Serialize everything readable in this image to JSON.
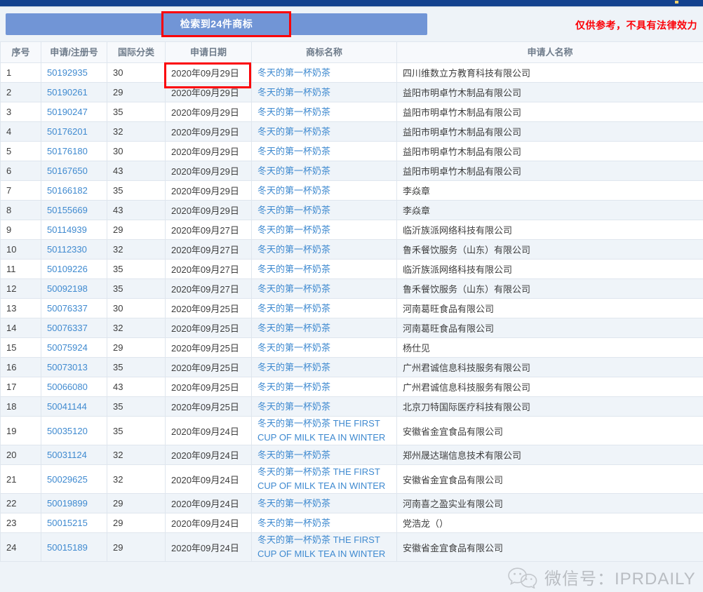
{
  "topbar": {
    "marker": ""
  },
  "banner": {
    "title": "检索到24件商标",
    "disclaimer": "仅供参考，不具有法律效力"
  },
  "table": {
    "headers": {
      "index": "序号",
      "app_no": "申请/注册号",
      "intl_class": "国际分类",
      "app_date": "申请日期",
      "tm_name": "商标名称",
      "applicant": "申请人名称"
    },
    "rows": [
      {
        "index": "1",
        "app_no": "50192935",
        "intl_class": "30",
        "app_date": "2020年09月29日",
        "tm_name": "冬天的第一杯奶茶",
        "applicant": "四川维数立方教育科技有限公司"
      },
      {
        "index": "2",
        "app_no": "50190261",
        "intl_class": "29",
        "app_date": "2020年09月29日",
        "tm_name": "冬天的第一杯奶茶",
        "applicant": "益阳市明卓竹木制品有限公司"
      },
      {
        "index": "3",
        "app_no": "50190247",
        "intl_class": "35",
        "app_date": "2020年09月29日",
        "tm_name": "冬天的第一杯奶茶",
        "applicant": "益阳市明卓竹木制品有限公司"
      },
      {
        "index": "4",
        "app_no": "50176201",
        "intl_class": "32",
        "app_date": "2020年09月29日",
        "tm_name": "冬天的第一杯奶茶",
        "applicant": "益阳市明卓竹木制品有限公司"
      },
      {
        "index": "5",
        "app_no": "50176180",
        "intl_class": "30",
        "app_date": "2020年09月29日",
        "tm_name": "冬天的第一杯奶茶",
        "applicant": "益阳市明卓竹木制品有限公司"
      },
      {
        "index": "6",
        "app_no": "50167650",
        "intl_class": "43",
        "app_date": "2020年09月29日",
        "tm_name": "冬天的第一杯奶茶",
        "applicant": "益阳市明卓竹木制品有限公司"
      },
      {
        "index": "7",
        "app_no": "50166182",
        "intl_class": "35",
        "app_date": "2020年09月29日",
        "tm_name": "冬天的第一杯奶茶",
        "applicant": "李焱章"
      },
      {
        "index": "8",
        "app_no": "50155669",
        "intl_class": "43",
        "app_date": "2020年09月29日",
        "tm_name": "冬天的第一杯奶茶",
        "applicant": "李焱章"
      },
      {
        "index": "9",
        "app_no": "50114939",
        "intl_class": "29",
        "app_date": "2020年09月27日",
        "tm_name": "冬天的第一杯奶茶",
        "applicant": "临沂族派网络科技有限公司"
      },
      {
        "index": "10",
        "app_no": "50112330",
        "intl_class": "32",
        "app_date": "2020年09月27日",
        "tm_name": "冬天的第一杯奶茶",
        "applicant": "鲁禾餐饮服务（山东）有限公司"
      },
      {
        "index": "11",
        "app_no": "50109226",
        "intl_class": "35",
        "app_date": "2020年09月27日",
        "tm_name": "冬天的第一杯奶茶",
        "applicant": "临沂族派网络科技有限公司"
      },
      {
        "index": "12",
        "app_no": "50092198",
        "intl_class": "35",
        "app_date": "2020年09月27日",
        "tm_name": "冬天的第一杯奶茶",
        "applicant": "鲁禾餐饮服务（山东）有限公司"
      },
      {
        "index": "13",
        "app_no": "50076337",
        "intl_class": "30",
        "app_date": "2020年09月25日",
        "tm_name": "冬天的第一杯奶茶",
        "applicant": "河南葛旺食品有限公司"
      },
      {
        "index": "14",
        "app_no": "50076337",
        "intl_class": "32",
        "app_date": "2020年09月25日",
        "tm_name": "冬天的第一杯奶茶",
        "applicant": "河南葛旺食品有限公司"
      },
      {
        "index": "15",
        "app_no": "50075924",
        "intl_class": "29",
        "app_date": "2020年09月25日",
        "tm_name": "冬天的第一杯奶茶",
        "applicant": "杨仕见"
      },
      {
        "index": "16",
        "app_no": "50073013",
        "intl_class": "35",
        "app_date": "2020年09月25日",
        "tm_name": "冬天的第一杯奶茶",
        "applicant": "广州君诚信息科技服务有限公司"
      },
      {
        "index": "17",
        "app_no": "50066080",
        "intl_class": "43",
        "app_date": "2020年09月25日",
        "tm_name": "冬天的第一杯奶茶",
        "applicant": "广州君诚信息科技服务有限公司"
      },
      {
        "index": "18",
        "app_no": "50041144",
        "intl_class": "35",
        "app_date": "2020年09月25日",
        "tm_name": "冬天的第一杯奶茶",
        "applicant": "北京刀特国际医疗科技有限公司"
      },
      {
        "index": "19",
        "app_no": "50035120",
        "intl_class": "35",
        "app_date": "2020年09月24日",
        "tm_name": "冬天的第一杯奶茶 THE FIRST CUP OF MILK TEA IN WINTER",
        "applicant": "安徽省金宜食品有限公司",
        "tall": true
      },
      {
        "index": "20",
        "app_no": "50031124",
        "intl_class": "32",
        "app_date": "2020年09月24日",
        "tm_name": "冬天的第一杯奶茶",
        "applicant": "郑州晟达瑞信息技术有限公司"
      },
      {
        "index": "21",
        "app_no": "50029625",
        "intl_class": "32",
        "app_date": "2020年09月24日",
        "tm_name": "冬天的第一杯奶茶 THE FIRST CUP OF MILK TEA IN WINTER",
        "applicant": "安徽省金宜食品有限公司",
        "tall": true
      },
      {
        "index": "22",
        "app_no": "50019899",
        "intl_class": "29",
        "app_date": "2020年09月24日",
        "tm_name": "冬天的第一杯奶茶",
        "applicant": "河南喜之盈实业有限公司"
      },
      {
        "index": "23",
        "app_no": "50015215",
        "intl_class": "29",
        "app_date": "2020年09月24日",
        "tm_name": "冬天的第一杯奶茶",
        "applicant": "党浩龙（）"
      },
      {
        "index": "24",
        "app_no": "50015189",
        "intl_class": "29",
        "app_date": "2020年09月24日",
        "tm_name": "冬天的第一杯奶茶 THE FIRST CUP OF MILK TEA IN WINTER",
        "applicant": "安徽省金宜食品有限公司",
        "tall": true
      }
    ]
  },
  "annotations": {
    "banner_box_color": "#fb0007",
    "date_box_color": "#fb0007"
  },
  "watermark": {
    "icon": "wechat-icon",
    "text": "微信号：IPRDAILY"
  },
  "colors": {
    "topbar": "#13428f",
    "banner": "#7195d6",
    "link": "#3f8ad0",
    "row_even": "#eff4f9",
    "header_bg": "#f7f9fc",
    "alert_red": "#fb0007"
  }
}
